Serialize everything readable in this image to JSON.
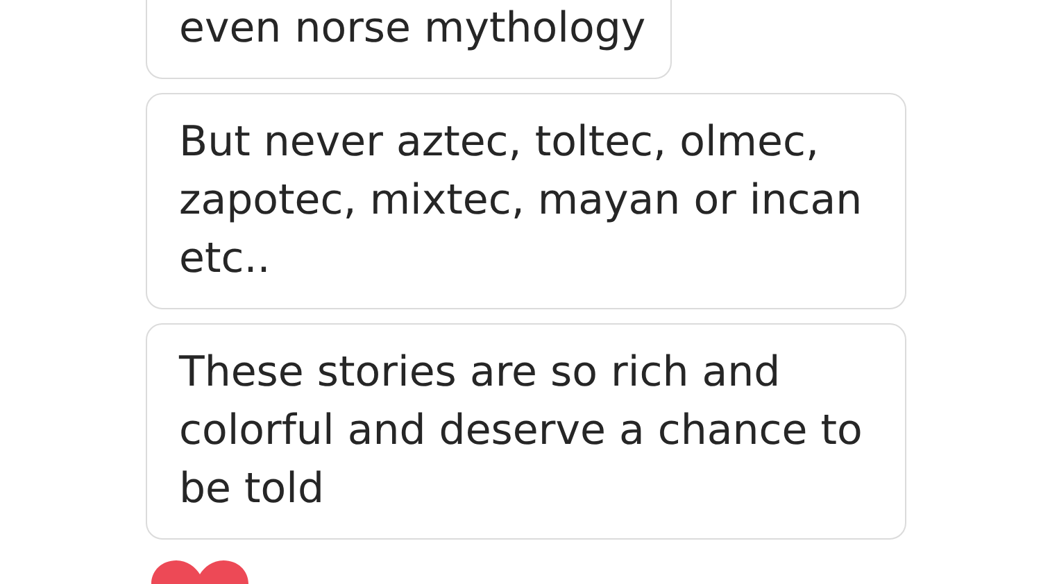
{
  "messages": [
    {
      "text": "even norse mythology"
    },
    {
      "text": "But never aztec, toltec, olmec, zapotec, mixtec, mayan or incan etc.."
    },
    {
      "text": "These stories are so rich and colorful and deserve a chance to be told"
    }
  ]
}
